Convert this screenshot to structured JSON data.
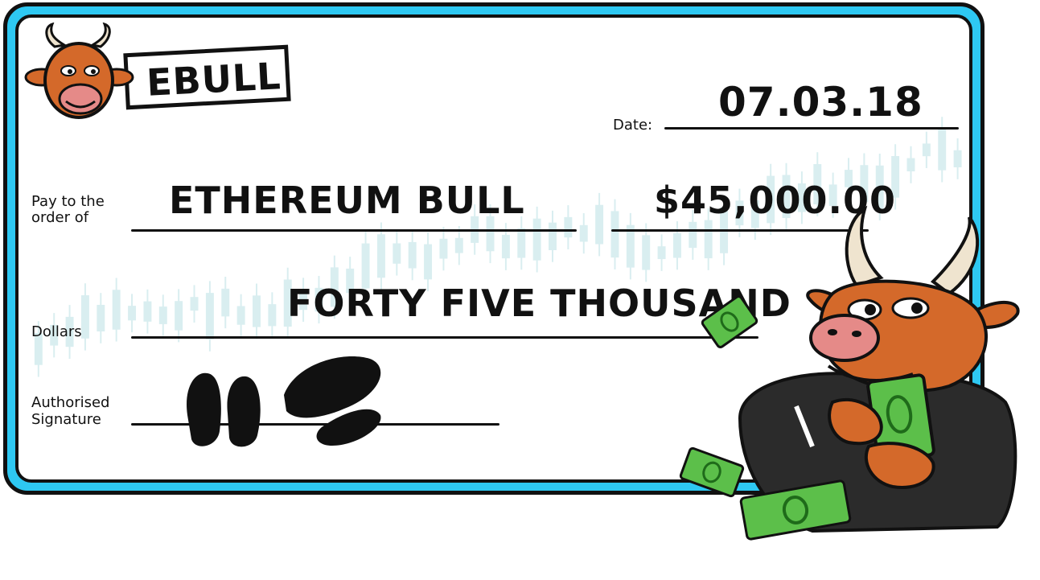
{
  "brand": {
    "logo_text": "EBULL"
  },
  "cheque": {
    "date_label": "Date:",
    "date_value": "07.03.18",
    "payee_label_line1": "Pay to the",
    "payee_label_line2": "order of",
    "payee_value": "ETHEREUM BULL",
    "amount_value": "$45,000.00",
    "words_value": "FORTY FIVE THOUSAND",
    "dollars_label": "Dollars",
    "signature_label_line1": "Authorised",
    "signature_label_line2": "Signature"
  },
  "colors": {
    "frame": "#2ec8f2",
    "ink": "#111111",
    "bull_skin": "#d4692a",
    "suit": "#2b2b2b",
    "money": "#5cbf4a",
    "chart_faint": "#d9eef0"
  },
  "icons": [
    "bull-mascot-logo",
    "hoof-print-signature-icon",
    "bull-mascot-illustration",
    "money-bill-icon"
  ]
}
